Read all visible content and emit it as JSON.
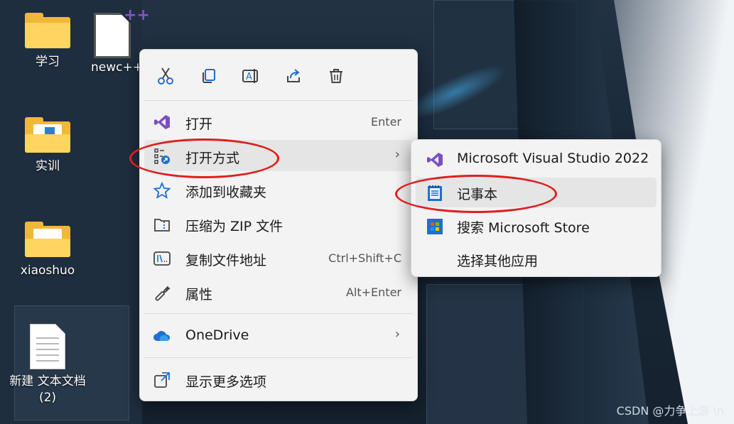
{
  "desktop": {
    "icons": [
      {
        "label": "学习",
        "type": "folder"
      },
      {
        "label": "newc++",
        "type": "cpp-file"
      },
      {
        "label": "实训",
        "type": "folder"
      },
      {
        "label": "xiaoshuo",
        "type": "folder"
      },
      {
        "label": "新建 文本文档 (2)",
        "type": "text-file"
      }
    ]
  },
  "context_menu": {
    "toolbar": [
      {
        "icon": "cut-icon"
      },
      {
        "icon": "copy-icon"
      },
      {
        "icon": "rename-icon"
      },
      {
        "icon": "share-icon"
      },
      {
        "icon": "delete-icon"
      }
    ],
    "items": [
      {
        "label": "打开",
        "shortcut": "Enter",
        "icon": "visual-studio-icon"
      },
      {
        "label": "打开方式",
        "icon": "open-with-icon",
        "has_submenu": true
      },
      {
        "label": "添加到收藏夹",
        "icon": "star-icon"
      },
      {
        "label": "压缩为 ZIP 文件",
        "icon": "zip-icon"
      },
      {
        "label": "复制文件地址",
        "shortcut": "Ctrl+Shift+C",
        "icon": "copy-path-icon"
      },
      {
        "label": "属性",
        "shortcut": "Alt+Enter",
        "icon": "wrench-icon"
      },
      {
        "label": "OneDrive",
        "icon": "onedrive-icon",
        "has_submenu": true
      },
      {
        "label": "显示更多选项",
        "icon": "show-more-icon"
      }
    ]
  },
  "submenu": {
    "items": [
      {
        "label": "Microsoft Visual Studio 2022",
        "icon": "visual-studio-icon"
      },
      {
        "label": "记事本",
        "icon": "notepad-icon"
      },
      {
        "label": "搜索 Microsoft Store",
        "icon": "store-icon"
      },
      {
        "label": "选择其他应用",
        "icon": ""
      }
    ]
  },
  "watermark": "CSDN @力争上游 \\n",
  "colors": {
    "menu_bg": "#f3f3f3",
    "hover_bg": "#e5e5e5",
    "annotation_red": "#e01e1e",
    "vs_purple": "#7b4fc4",
    "windows_blue": "#1f6fd0"
  }
}
